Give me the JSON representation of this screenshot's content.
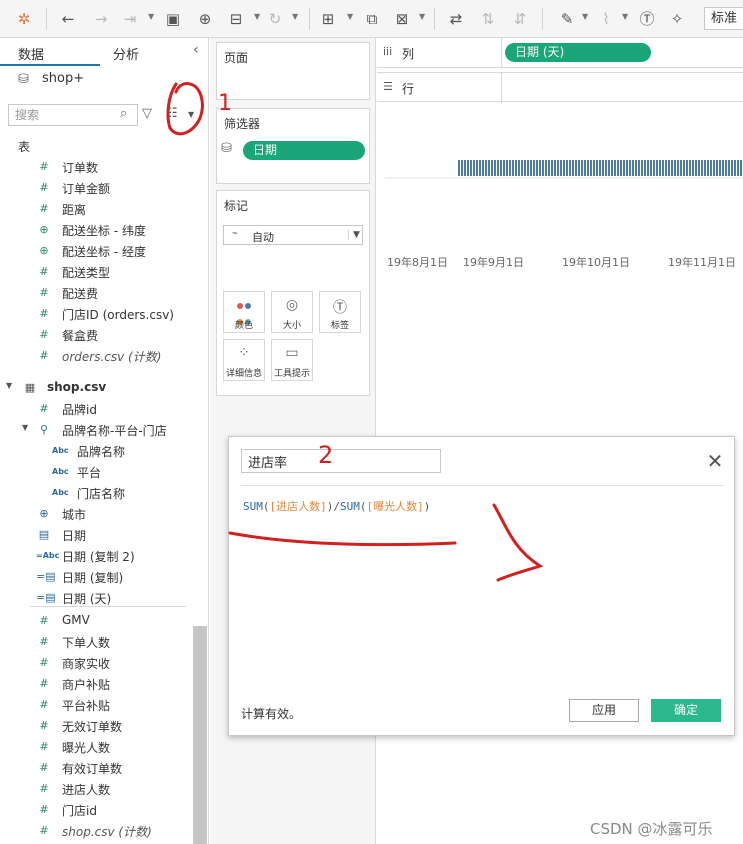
{
  "toolbar": {
    "standard_label": "标准"
  },
  "data_pane": {
    "tab_data": "数据",
    "tab_analysis": "分析",
    "source_name": "shop+",
    "search_placeholder": "搜索",
    "section_tables": "表",
    "orders_fields": [
      {
        "type": "measure",
        "label": "订单数"
      },
      {
        "type": "measure",
        "label": "订单金额"
      },
      {
        "type": "measure",
        "label": "距离"
      },
      {
        "type": "geo",
        "label": "配送坐标 - 纬度"
      },
      {
        "type": "geo",
        "label": "配送坐标 - 经度"
      },
      {
        "type": "measure",
        "label": "配送类型"
      },
      {
        "type": "measure",
        "label": "配送费"
      },
      {
        "type": "measure",
        "label": "门店ID (orders.csv)"
      },
      {
        "type": "measure",
        "label": "餐盒费"
      },
      {
        "type": "count",
        "label": "orders.csv (计数)"
      }
    ],
    "shop_table": "shop.csv",
    "shop_fields": [
      {
        "type": "dim-measure",
        "label": "品牌id"
      },
      {
        "type": "hierarchy",
        "label": "品牌名称-平台-门店"
      },
      {
        "type": "abc",
        "label": "品牌名称"
      },
      {
        "type": "abc",
        "label": "平台"
      },
      {
        "type": "abc",
        "label": "门店名称"
      },
      {
        "type": "geo-blue",
        "label": "城市"
      },
      {
        "type": "date",
        "label": "日期"
      },
      {
        "type": "abc-eq",
        "label": "日期 (复制 2)"
      },
      {
        "type": "date-eq",
        "label": "日期 (复制)"
      },
      {
        "type": "date-eq",
        "label": "日期 (天)"
      }
    ],
    "shop_measures": [
      {
        "type": "measure",
        "label": "GMV"
      },
      {
        "type": "measure",
        "label": "下单人数"
      },
      {
        "type": "measure",
        "label": "商家实收"
      },
      {
        "type": "measure",
        "label": "商户补贴"
      },
      {
        "type": "measure",
        "label": "平台补贴"
      },
      {
        "type": "measure",
        "label": "无效订单数"
      },
      {
        "type": "measure",
        "label": "曝光人数"
      },
      {
        "type": "measure",
        "label": "有效订单数"
      },
      {
        "type": "measure",
        "label": "进店人数"
      },
      {
        "type": "measure",
        "label": "门店id"
      },
      {
        "type": "count",
        "label": "shop.csv (计数)"
      }
    ]
  },
  "shelves": {
    "pages_title": "页面",
    "filters_title": "筛选器",
    "filter_pill": "日期",
    "marks_title": "标记",
    "mark_type": "自动",
    "mark_buttons": [
      {
        "icon": "color-icon",
        "label": "颜色"
      },
      {
        "icon": "size-icon",
        "label": "大小"
      },
      {
        "icon": "label-icon",
        "label": "标签"
      },
      {
        "icon": "detail-icon",
        "label": "详细信息"
      },
      {
        "icon": "tooltip-icon",
        "label": "工具提示"
      }
    ],
    "columns_label": "列",
    "columns_pill": "日期 (天)",
    "rows_label": "行"
  },
  "viz": {
    "axis_ticks": [
      "19年8月1日",
      "19年9月1日",
      "19年10月1日",
      "19年11月1日"
    ],
    "bar_color": "#4e79a7"
  },
  "calc_dialog": {
    "name": "进店率",
    "formula": {
      "fn1": "SUM",
      "field1": "[进店人数]",
      "fn2": "SUM",
      "field2": "[曝光人数]"
    },
    "status": "计算有效。",
    "apply_label": "应用",
    "ok_label": "确定"
  },
  "annotation_marks": [
    "1",
    "2"
  ],
  "watermark": "CSDN @冰露可乐"
}
